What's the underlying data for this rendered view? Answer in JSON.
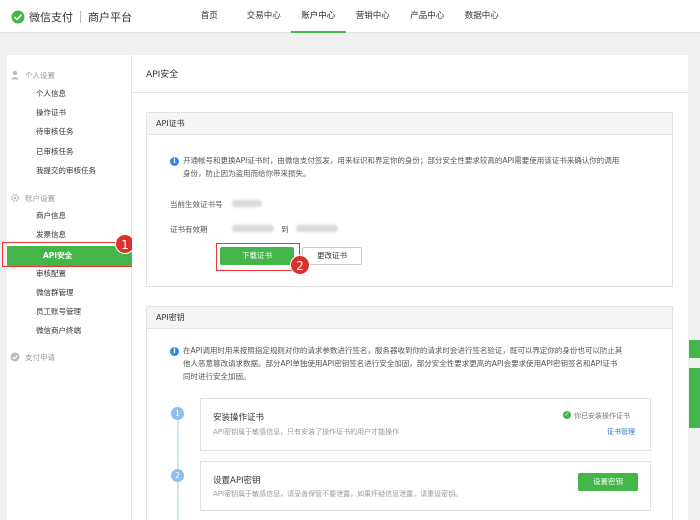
{
  "header": {
    "logo_text": "微信支付",
    "platform": "商户平台",
    "nav": [
      {
        "label": "首页"
      },
      {
        "label": "交易中心"
      },
      {
        "label": "账户中心"
      },
      {
        "label": "营销中心"
      },
      {
        "label": "产品中心"
      },
      {
        "label": "数据中心"
      }
    ],
    "active_nav": "账户中心"
  },
  "sidebar": {
    "group1": {
      "label": "个人设置",
      "icon": "person-icon"
    },
    "group1_items": [
      "个人信息",
      "操作证书",
      "待审核任务",
      "已审核任务",
      "我提交的审核任务"
    ],
    "group2": {
      "label": "账户设置",
      "icon": "gear-icon"
    },
    "group2_items": [
      "商户信息",
      "发票信息",
      "API安全",
      "审核配置",
      "微信群管理",
      "员工账号管理",
      "微信商户终端"
    ],
    "group3": {
      "label": "支付申请",
      "icon": "check-circle-icon"
    },
    "active_item": "API安全"
  },
  "annotations": {
    "badge1": "1",
    "badge2": "2"
  },
  "main": {
    "title": "API安全",
    "cert_panel": {
      "title": "API证书",
      "info_line1": "开通帐号和更换API证书时，由微信支付签发，用来标识和界定你的身份；部分安全性要求较高的API需要使用该证书来确认你的调用",
      "info_line2": "身份，防止因为盗用而给你带来损失。",
      "current_label": "当前生效证书号",
      "validity_label": "证书有效期",
      "to_label": "到",
      "download_btn": "下载证书",
      "change_btn": "更改证书"
    },
    "key_panel": {
      "title": "API密钥",
      "info_line1": "在API调用时用来按照指定规则对你的请求参数进行签名，服务器收到你的请求时会进行签名验证，既可以界定你的身份也可以防止其",
      "info_line2": "他人恶意篡改请求数据。部分API单独使用API密钥签名进行安全加固，部分安全性要求更高的API会要求使用API密钥签名和API证书",
      "info_line3": "同时进行安全加固。",
      "steps": [
        {
          "num": "1",
          "title": "安装操作证书",
          "desc": "API密钥属于敏感信息，只有安装了操作证书的用户才能操作",
          "status": "你已安装操作证书",
          "link": "证书管理"
        },
        {
          "num": "2",
          "title": "设置API密钥",
          "desc": "API密钥属于敏感信息，请妥善保管不要泄露，如果怀疑信息泄露，请重设密钥。",
          "button": "设置密钥"
        }
      ]
    }
  },
  "colors": {
    "accent": "#44b549",
    "annotation": "#d9312b",
    "info": "#2e8ae6",
    "link": "#2e72c4"
  }
}
